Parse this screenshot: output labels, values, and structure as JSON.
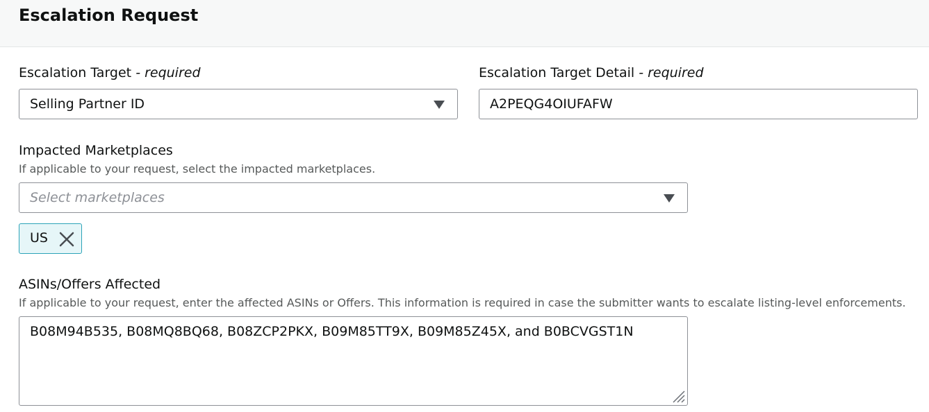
{
  "header": {
    "title": "Escalation Request"
  },
  "escalation_target": {
    "label": "Escalation Target",
    "required_text": "- required",
    "selected": "Selling Partner ID"
  },
  "escalation_target_detail": {
    "label": "Escalation Target Detail",
    "required_text": "- required",
    "value": "A2PEQG4OIUFAFW"
  },
  "impacted_marketplaces": {
    "label": "Impacted Marketplaces",
    "help": "If applicable to your request, select the impacted marketplaces.",
    "placeholder": "Select marketplaces",
    "tokens": [
      "US"
    ]
  },
  "asins": {
    "label": "ASINs/Offers Affected",
    "help": "If applicable to your request, enter the affected ASINs or Offers. This information is required in case the submitter wants to escalate listing-level enforcements.",
    "value": "B08M94B535, B08MQ8BQ68, B08ZCP2PKX, B09M85TT9X, B09M85Z45X, and B0BCVGST1N"
  },
  "colors": {
    "token_bg": "#e6f6f8",
    "token_border": "#2ba3b8",
    "input_border": "#8d9096",
    "help_text": "#565959"
  }
}
